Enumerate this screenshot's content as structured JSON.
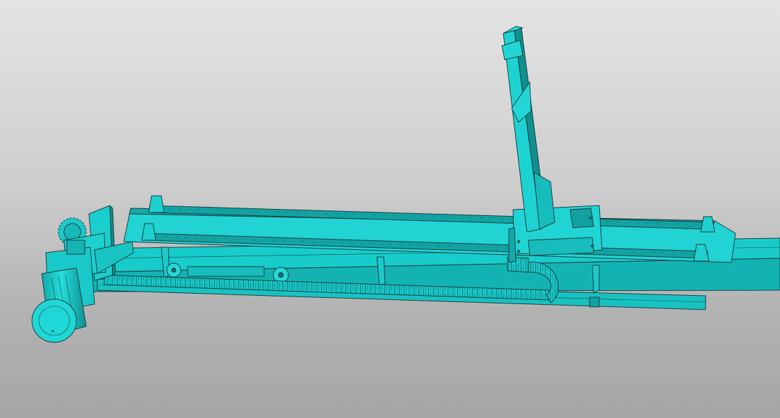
{
  "viewport": {
    "background_top": "#e4e4e4",
    "background_bottom": "#a6a6a6"
  },
  "model": {
    "color": "#1ccfcf",
    "shade": "#14a9a9",
    "dark": "#0b6f6f",
    "edge_color": "#1d3f3f"
  }
}
